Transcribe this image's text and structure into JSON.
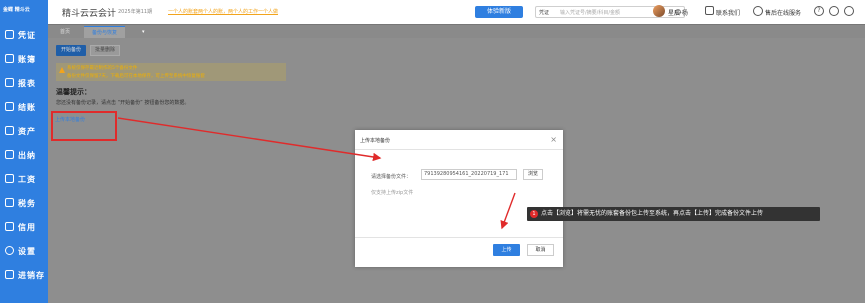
{
  "sidebar": {
    "logo": "金蝶 精斗云",
    "items": [
      {
        "label": "凭证"
      },
      {
        "label": "账簿"
      },
      {
        "label": "报表"
      },
      {
        "label": "结账"
      },
      {
        "label": "资产"
      },
      {
        "label": "出纳"
      },
      {
        "label": "工资"
      },
      {
        "label": "税务"
      },
      {
        "label": "信用"
      },
      {
        "label": "设置"
      },
      {
        "label": "进销存"
      }
    ]
  },
  "topbar": {
    "app_title": "精斗云云会计",
    "period": "2025年第11期",
    "notice": "一个人的账套两个人的账，两个人的工作一个人做",
    "experience_btn": "体验新版",
    "search_type": "凭证",
    "search_placeholder": "输入凭证号/摘要/科目/金额",
    "user_name": "星辰·杨",
    "contact": "联系我们",
    "online_service": "售后在线服务",
    "help_icon_glyph": "?"
  },
  "tabs": [
    {
      "label": "首页",
      "active": false
    },
    {
      "label": "备份与恢复",
      "active": true
    }
  ],
  "content": {
    "start_backup_btn": "开始备份",
    "batch_delete_btn": "批量删除",
    "warn_line1": "系统仅保存最近制作的5个备份文件",
    "warn_line2": "备份文件仅保留7天，下载后可在本地保存，可上传至系统中恢复账套",
    "warm_title": "温馨提示：",
    "warm_text": "您还没有备份记录，请点击 “开始备份” 按钮备份您的数据。",
    "upload_local_link": "上传本地备份"
  },
  "dialog": {
    "title": "上传本地备份",
    "file_label": "请选择备份文件：",
    "file_value": "79139280954161_20220719_171",
    "browse_btn": "浏览",
    "hint": "仅支持上传zip文件",
    "upload_btn": "上传",
    "cancel_btn": "取消"
  },
  "tip": {
    "number": "1",
    "text": "点击【浏览】将需无忧的账套备份包上传至系统，再点击【上传】完成备份文件上传"
  },
  "colors": {
    "primary": "#2f7fe0",
    "annotation_red": "#e02b2b",
    "warning": "#f2a41c"
  }
}
